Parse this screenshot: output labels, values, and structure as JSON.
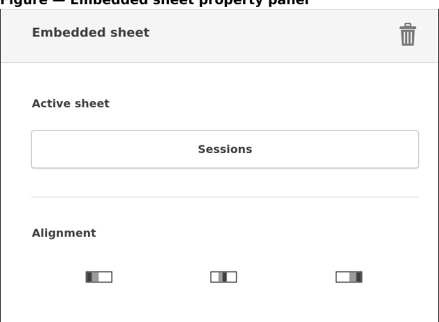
{
  "top_caption": "Figure — Embedded sheet property panel",
  "panel": {
    "title": "Embedded sheet",
    "delete_icon": "trash-icon"
  },
  "active_sheet": {
    "label": "Active sheet",
    "selected": "Sessions"
  },
  "alignment": {
    "label": "Alignment",
    "options": [
      {
        "name": "align-left",
        "icon": "align-left-icon"
      },
      {
        "name": "align-center",
        "icon": "align-center-icon"
      },
      {
        "name": "align-right",
        "icon": "align-right-icon"
      }
    ]
  },
  "colors": {
    "header_bg": "#f5f5f5",
    "text": "#404040",
    "border": "#bdbdbd"
  }
}
